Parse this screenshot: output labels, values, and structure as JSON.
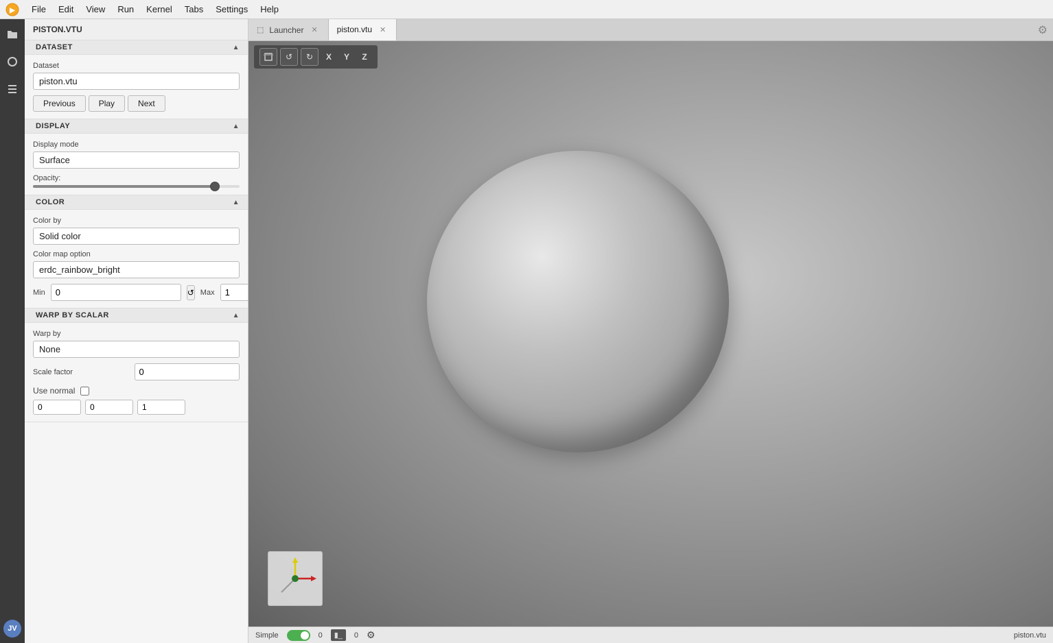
{
  "menubar": {
    "items": [
      "File",
      "Edit",
      "View",
      "Run",
      "Kernel",
      "Tabs",
      "Settings",
      "Help"
    ]
  },
  "left_panel_title": "PISTON.VTU",
  "sections": {
    "dataset": {
      "header": "DATASET",
      "dataset_label": "Dataset",
      "dataset_value": "piston.vtu",
      "btn_previous": "Previous",
      "btn_play": "Play",
      "btn_next": "Next"
    },
    "display": {
      "header": "DISPLAY",
      "display_mode_label": "Display mode",
      "display_mode_value": "Surface",
      "opacity_label": "Opacity:",
      "opacity_value": 90
    },
    "color": {
      "header": "COLOR",
      "color_by_label": "Color by",
      "color_by_value": "Solid color",
      "color_map_label": "Color map option",
      "color_map_value": "erdc_rainbow_bright",
      "min_label": "Min",
      "min_value": "0",
      "max_label": "Max",
      "max_value": "1"
    },
    "warp": {
      "header": "WARP BY SCALAR",
      "warp_by_label": "Warp by",
      "warp_by_value": "None",
      "scale_factor_label": "Scale factor",
      "scale_factor_value": "0",
      "use_normal_label": "Use normal",
      "normal_x": "0",
      "normal_y": "0",
      "normal_z": "1"
    }
  },
  "tabs": [
    {
      "label": "Launcher",
      "active": false,
      "closable": true
    },
    {
      "label": "piston.vtu",
      "active": true,
      "closable": true
    }
  ],
  "viewport_toolbar": {
    "btns": [
      "⊡",
      "↺",
      "↻"
    ],
    "axes": [
      "X",
      "Y",
      "Z"
    ]
  },
  "status_bar": {
    "mode": "Simple",
    "count1": "0",
    "count2": "0",
    "filename": "piston.vtu"
  },
  "iconbar": {
    "icons": [
      "folder",
      "circle",
      "list"
    ],
    "avatar": "JV"
  }
}
